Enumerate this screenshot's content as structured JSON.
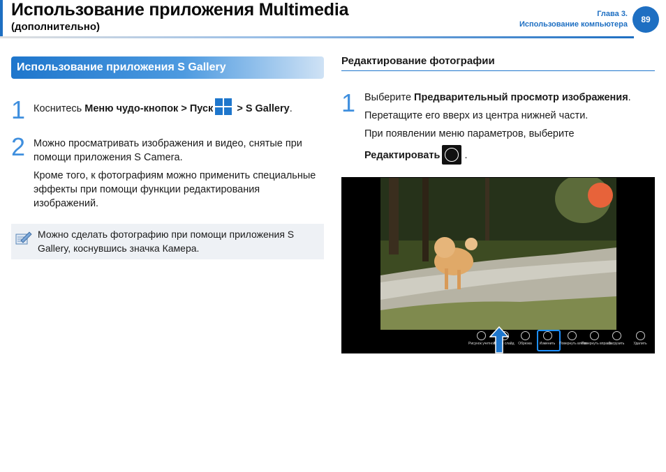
{
  "header": {
    "title": "Использование приложения Multimedia",
    "subtitle": "(дополнительно)",
    "chapter_line1": "Глава 3.",
    "chapter_line2": "Использование компьютера",
    "page_number": "89",
    "accent_color": "#1e6fc2"
  },
  "left": {
    "section_title": "Использование приложения S Gallery",
    "step1": {
      "num": "1",
      "text_pre": "Коснитесь ",
      "bold1": "Меню чудо-кнопок > Пуск",
      "bold2": " > S Gallery",
      "text_post": "."
    },
    "step2": {
      "num": "2",
      "para1": "Можно просматривать изображения и видео, снятые при помощи приложения S Camera.",
      "para2": "Кроме того, к фотографиям можно применить специальные эффекты при помощи функции редактирования изображений."
    },
    "note": "Можно сделать фотографию при помощи приложения S Gallery, коснувшись значка Камера."
  },
  "right": {
    "section_title": "Редактирование фотографии",
    "step1": {
      "num": "1",
      "line1_pre": "Выберите ",
      "line1_bold": "Предварительный просмотр изображения",
      "line1_post": ".",
      "line2": "Перетащите его вверх из центра нижней части.",
      "line3": "При появлении меню параметров, выберите",
      "line4_bold": "Редактировать",
      "line4_post": " ."
    }
  },
  "screenshot": {
    "appbar": [
      {
        "label": "Рисунок учетной",
        "icon": "user-picture-icon"
      },
      {
        "label": "Показ слайд",
        "icon": "slideshow-icon"
      },
      {
        "label": "Обрезка",
        "icon": "crop-icon"
      },
      {
        "label": "Изменить",
        "icon": "edit-icon"
      },
      {
        "label": "Повернуть влево",
        "icon": "rotate-left-icon"
      },
      {
        "label": "Повернуть вправо",
        "icon": "rotate-right-icon"
      },
      {
        "label": "Загрузить",
        "icon": "upload-icon"
      },
      {
        "label": "Удалить",
        "icon": "delete-icon"
      }
    ]
  }
}
